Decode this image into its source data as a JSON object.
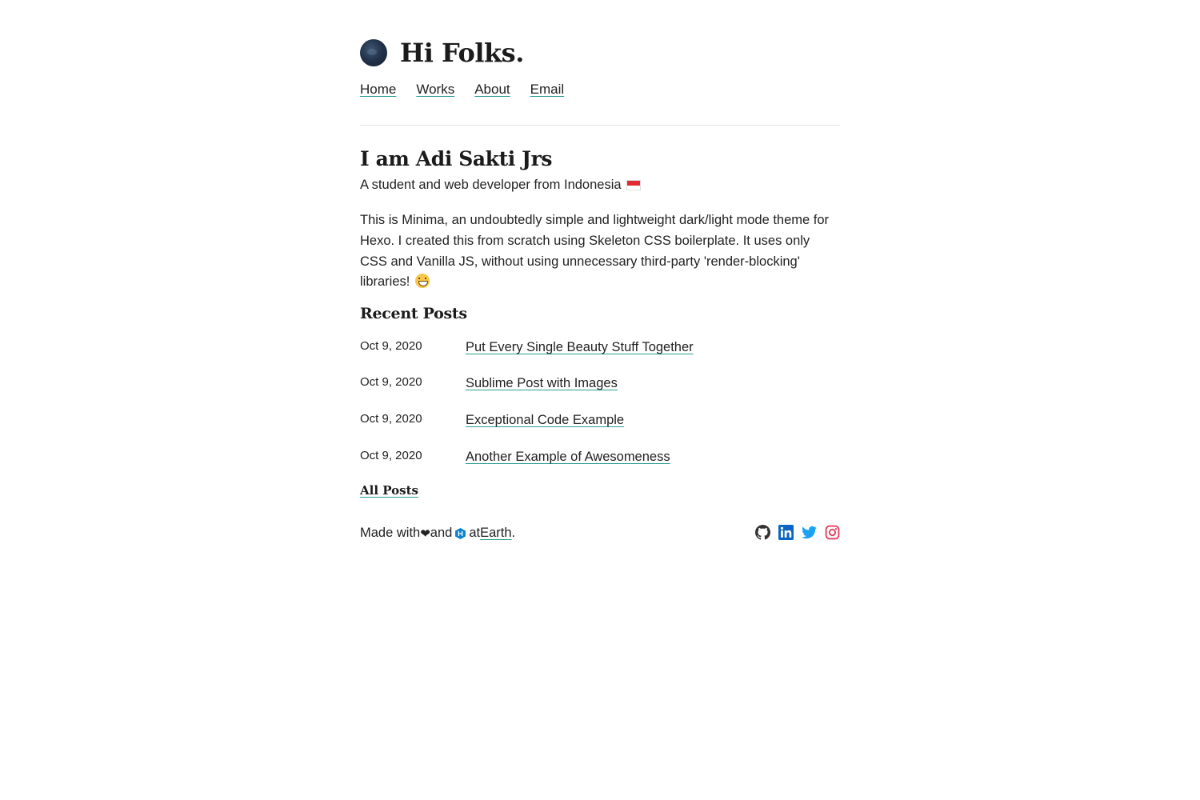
{
  "header": {
    "title": "Hi Folks.",
    "avatar_icon": "earth-globe-avatar"
  },
  "nav": [
    {
      "label": "Home"
    },
    {
      "label": "Works"
    },
    {
      "label": "About"
    },
    {
      "label": "Email"
    }
  ],
  "intro": {
    "title": "I am Adi Sakti Jrs",
    "subtitle": "A student and web developer from Indonesia",
    "flag_icon": "indonesia-flag-icon",
    "paragraph": "This is Minima, an undoubtedly simple and lightweight dark/light mode theme for Hexo. I created this from scratch using Skeleton CSS boilerplate. It uses only CSS and Vanilla JS, without using unnecessary third-party 'render-blocking' libraries!",
    "emoji_icon": "grinning-face-icon"
  },
  "recent": {
    "title": "Recent Posts",
    "posts": [
      {
        "date": "Oct 9, 2020",
        "title": "Put Every Single Beauty Stuff Together"
      },
      {
        "date": "Oct 9, 2020",
        "title": "Sublime Post with Images"
      },
      {
        "date": "Oct 9, 2020",
        "title": "Exceptional Code Example"
      },
      {
        "date": "Oct 9, 2020",
        "title": "Another Example of Awesomeness"
      }
    ],
    "all_posts_label": "All Posts"
  },
  "footer": {
    "made_with": "Made with",
    "heart": "❤",
    "and": "and",
    "hexo_icon": "hexo-icon",
    "at": "at",
    "earth_link": "Earth",
    "period": ".",
    "socials": [
      {
        "name": "github-icon",
        "color": "#333333"
      },
      {
        "name": "linkedin-icon",
        "color": "#0a66c2"
      },
      {
        "name": "twitter-icon",
        "color": "#1da1f2"
      },
      {
        "name": "instagram-icon",
        "color": "#e4405f"
      }
    ]
  },
  "colors": {
    "accent_underline": "#2a9d8f",
    "text": "#222222",
    "background": "#ffffff",
    "hexo_blue": "#0e83cd"
  }
}
